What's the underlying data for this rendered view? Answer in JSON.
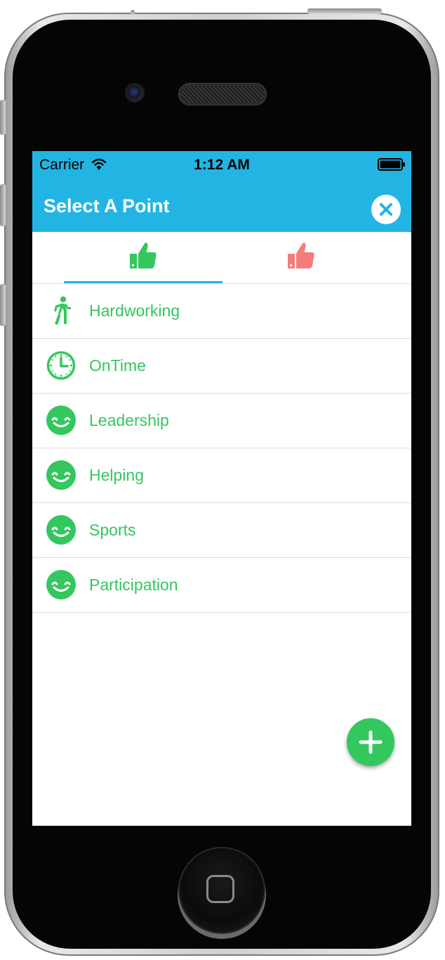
{
  "status_bar": {
    "carrier": "Carrier",
    "time": "1:12 AM"
  },
  "app_bar": {
    "title": "Select A Point"
  },
  "tabs": [
    {
      "icon": "thumbs-up-icon",
      "color": "#33c75e",
      "selected": true
    },
    {
      "icon": "thumbs-up-icon",
      "color": "#f47c7c",
      "selected": false
    }
  ],
  "points": [
    {
      "label": "Hardworking",
      "icon": "walking-person-icon"
    },
    {
      "label": "OnTime",
      "icon": "clock-icon"
    },
    {
      "label": "Leadership",
      "icon": "smiley-icon"
    },
    {
      "label": "Helping",
      "icon": "smiley-icon"
    },
    {
      "label": "Sports",
      "icon": "smiley-icon"
    },
    {
      "label": "Participation",
      "icon": "smiley-icon"
    }
  ],
  "colors": {
    "header": "#22b5e4",
    "accent_green": "#33c75e",
    "accent_red": "#f47c7c"
  }
}
